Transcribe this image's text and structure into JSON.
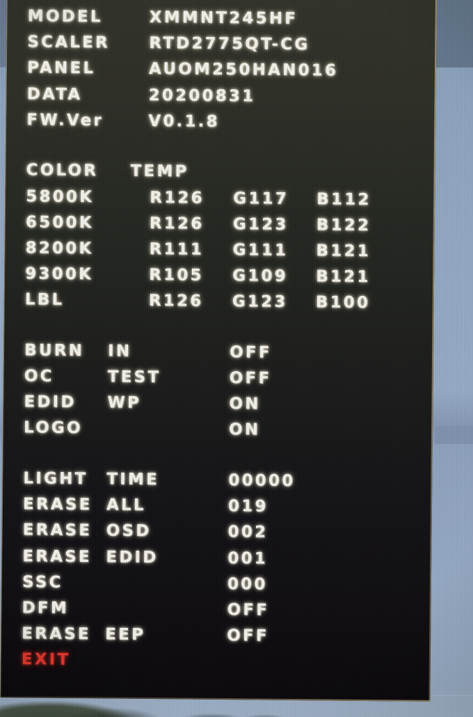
{
  "screen": {
    "kind": "monitor-factory-osd",
    "accent_text_color": "#f3f1ea",
    "exit_color": "#e8382f",
    "panel_bg_top": "#32332a",
    "panel_bg_bottom": "#0b090d",
    "wallpaper_sky": "#93a9c5"
  },
  "info": [
    {
      "label": "MODEL",
      "value": "XMMNT245HF"
    },
    {
      "label": "SCALER",
      "value": "RTD2775QT-CG"
    },
    {
      "label": "PANEL",
      "value": "AUOM250HAN016"
    },
    {
      "label": "DATA",
      "value": "20200831"
    },
    {
      "label": "FW.Ver",
      "value": "V0.1.8"
    }
  ],
  "color_temp": {
    "heading_label": "COLOR",
    "heading_sub": "TEMP",
    "rows": [
      {
        "name": "5800K",
        "r": "R126",
        "g": "G117",
        "b": "B112"
      },
      {
        "name": "6500K",
        "r": "R126",
        "g": "G123",
        "b": "B122"
      },
      {
        "name": "8200K",
        "r": "R111",
        "g": "G111",
        "b": "B121"
      },
      {
        "name": "9300K",
        "r": "R105",
        "g": "G109",
        "b": "B121"
      },
      {
        "name": "LBL",
        "r": "R126",
        "g": "G123",
        "b": "B100"
      }
    ]
  },
  "toggles": [
    {
      "label": "BURN",
      "sub": "IN",
      "value": "OFF"
    },
    {
      "label": "OC",
      "sub": "TEST",
      "value": "OFF"
    },
    {
      "label": "EDID",
      "sub": "WP",
      "value": "ON"
    },
    {
      "label": "LOGO",
      "sub": "",
      "value": "ON"
    }
  ],
  "counters": [
    {
      "label": "LIGHT",
      "sub": "TIME",
      "value": "00000"
    },
    {
      "label": "ERASE",
      "sub": "ALL",
      "value": "019"
    },
    {
      "label": "ERASE",
      "sub": "OSD",
      "value": "002"
    },
    {
      "label": "ERASE",
      "sub": "EDID",
      "value": "001"
    },
    {
      "label": "SSC",
      "sub": "",
      "value": "000"
    },
    {
      "label": "DFM",
      "sub": "",
      "value": "OFF"
    },
    {
      "label": "ERASE",
      "sub": "EEP",
      "value": "OFF"
    }
  ],
  "exit": {
    "label": "EXIT"
  }
}
